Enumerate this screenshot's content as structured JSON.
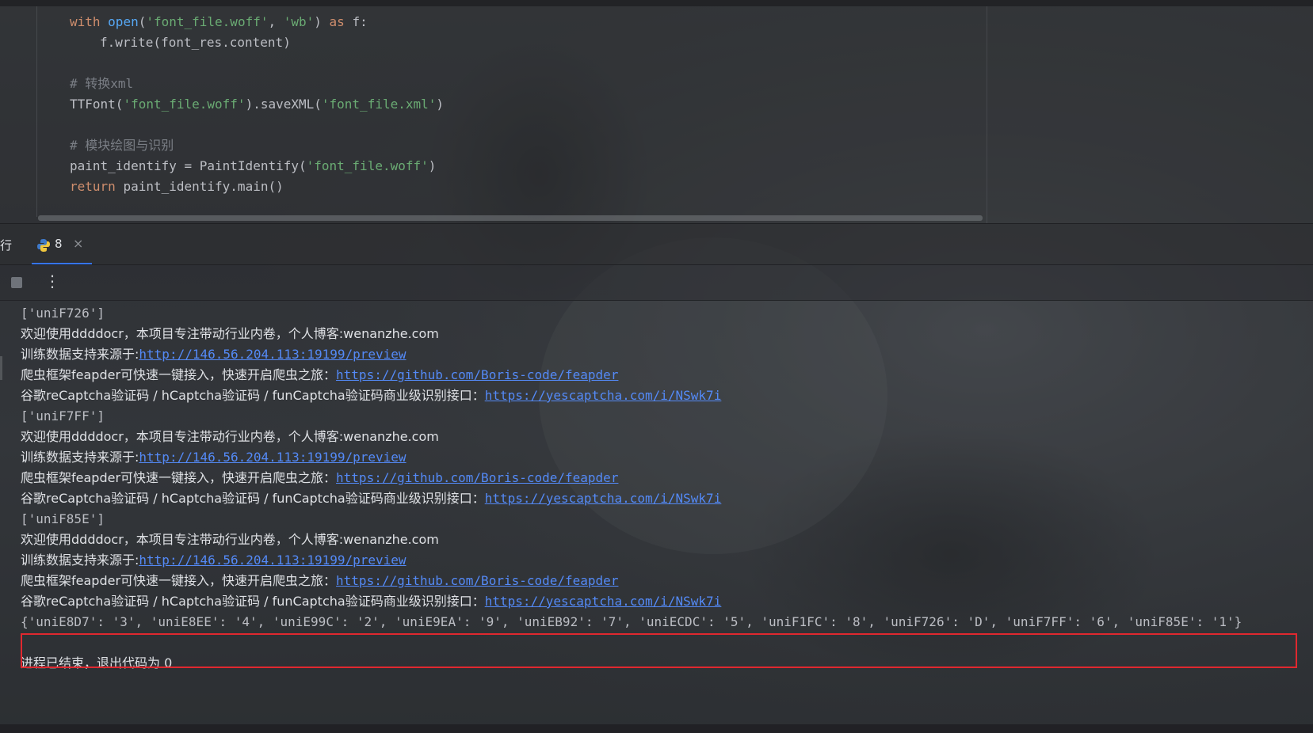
{
  "editor": {
    "lines": [
      {
        "parts": [
          [
            "kw",
            "with "
          ],
          [
            "fn",
            "open"
          ],
          [
            "plain",
            "("
          ],
          [
            "str",
            "'font_file.woff'"
          ],
          [
            "plain",
            ", "
          ],
          [
            "str",
            "'wb'"
          ],
          [
            "plain",
            ") "
          ],
          [
            "kw",
            "as "
          ],
          [
            "plain",
            "f:"
          ]
        ]
      },
      {
        "indent": true,
        "parts": [
          [
            "plain",
            "f.write(font_res.content)"
          ]
        ]
      },
      {
        "parts": []
      },
      {
        "parts": [
          [
            "cm",
            "# 转换xml"
          ]
        ]
      },
      {
        "parts": [
          [
            "plain",
            "TTFont("
          ],
          [
            "str",
            "'font_file.woff'"
          ],
          [
            "plain",
            ").saveXML("
          ],
          [
            "str",
            "'font_file.xml'"
          ],
          [
            "plain",
            ")"
          ]
        ]
      },
      {
        "parts": []
      },
      {
        "parts": [
          [
            "cm",
            "# 模块绘图与识别"
          ]
        ]
      },
      {
        "parts": [
          [
            "plain",
            "paint_identify = PaintIdentify("
          ],
          [
            "str",
            "'font_file.woff'"
          ],
          [
            "plain",
            ")"
          ]
        ]
      },
      {
        "parts": [
          [
            "kw",
            "return "
          ],
          [
            "plain",
            "paint_identify.main()"
          ]
        ]
      }
    ]
  },
  "run_panel": {
    "title": "行",
    "tab_label": "8",
    "tab_close": "×"
  },
  "toolbar": {
    "more_glyph": "⋮"
  },
  "console": {
    "lines": [
      [
        [
          "zh",
          "谷歌reCaptcha验证码 / hCaptcha验证码 / funCaptcha验证码商业级识别接口："
        ],
        [
          "link",
          "https://yescaptcha.com/i/NSwk7i"
        ]
      ],
      [
        [
          "plain",
          "['uniF726']"
        ]
      ],
      [
        [
          "zh",
          "欢迎使用ddddocr，本项目专注带动行业内卷，个人博客:wenanzhe.com"
        ]
      ],
      [
        [
          "zh",
          "训练数据支持来源于:"
        ],
        [
          "link",
          "http://146.56.204.113:19199/preview"
        ]
      ],
      [
        [
          "zh",
          "爬虫框架feapder可快速一键接入，快速开启爬虫之旅："
        ],
        [
          "link",
          "https://github.com/Boris-code/feapder"
        ]
      ],
      [
        [
          "zh",
          "谷歌reCaptcha验证码 / hCaptcha验证码 / funCaptcha验证码商业级识别接口："
        ],
        [
          "link",
          "https://yescaptcha.com/i/NSwk7i"
        ]
      ],
      [
        [
          "plain",
          "['uniF7FF']"
        ]
      ],
      [
        [
          "zh",
          "欢迎使用ddddocr，本项目专注带动行业内卷，个人博客:wenanzhe.com"
        ]
      ],
      [
        [
          "zh",
          "训练数据支持来源于:"
        ],
        [
          "link",
          "http://146.56.204.113:19199/preview"
        ]
      ],
      [
        [
          "zh",
          "爬虫框架feapder可快速一键接入，快速开启爬虫之旅："
        ],
        [
          "link",
          "https://github.com/Boris-code/feapder"
        ]
      ],
      [
        [
          "zh",
          "谷歌reCaptcha验证码 / hCaptcha验证码 / funCaptcha验证码商业级识别接口："
        ],
        [
          "link",
          "https://yescaptcha.com/i/NSwk7i"
        ]
      ],
      [
        [
          "plain",
          "['uniF85E']"
        ]
      ],
      [
        [
          "zh",
          "欢迎使用ddddocr，本项目专注带动行业内卷，个人博客:wenanzhe.com"
        ]
      ],
      [
        [
          "zh",
          "训练数据支持来源于:"
        ],
        [
          "link",
          "http://146.56.204.113:19199/preview"
        ]
      ],
      [
        [
          "zh",
          "爬虫框架feapder可快速一键接入，快速开启爬虫之旅："
        ],
        [
          "link",
          "https://github.com/Boris-code/feapder"
        ]
      ],
      [
        [
          "zh",
          "谷歌reCaptcha验证码 / hCaptcha验证码 / funCaptcha验证码商业级识别接口："
        ],
        [
          "link",
          "https://yescaptcha.com/i/NSwk7i"
        ]
      ],
      [
        [
          "plain",
          "{'uniE8D7': '3', 'uniE8EE': '4', 'uniE99C': '2', 'uniE9EA': '9', 'uniEB92': '7', 'uniECDC': '5', 'uniF1FC': '8', 'uniF726': 'D', 'uniF7FF': '6', 'uniF85E': '1'}"
        ]
      ],
      [],
      [
        [
          "zh",
          "进程已结束，退出代码为 0"
        ]
      ]
    ]
  },
  "colors": {
    "highlight_box": "#e0282f",
    "link": "#548af7",
    "tab_accent": "#3574f0"
  }
}
